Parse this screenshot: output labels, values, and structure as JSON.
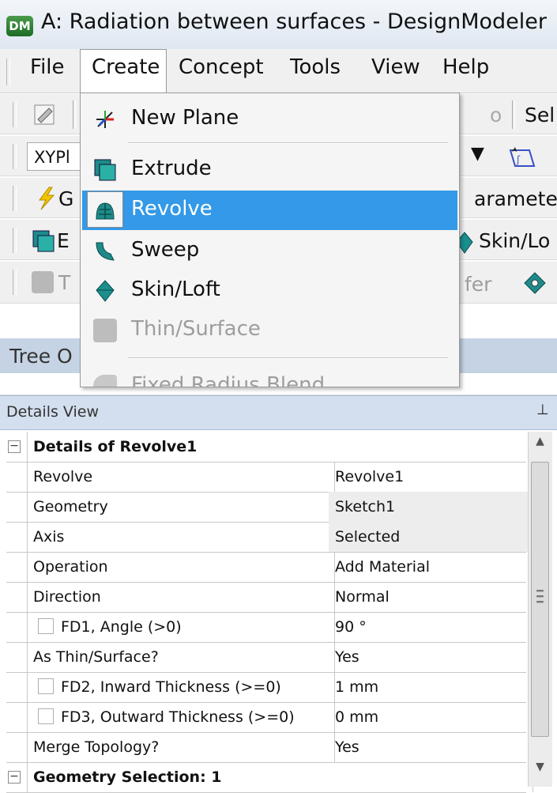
{
  "window": {
    "app_badge": "DM",
    "title": "A: Radiation between surfaces - DesignModeler"
  },
  "menubar": {
    "items": [
      "File",
      "Create",
      "Concept",
      "Tools",
      "View",
      "Help"
    ]
  },
  "toolbars": {
    "row1_partial_right_1": "o",
    "row1_partial_right_2": "Sel",
    "row2_plane_value": "XYPl",
    "row3_left_partial": "G",
    "row3_right_partial": "aramete",
    "row4_left_partial": "E",
    "row4_right_partial": "Skin/Lo",
    "row5_left_partial": "T",
    "row5_right_partial": "fer"
  },
  "tree_outline": {
    "title_partial": "Tree O"
  },
  "create_menu": {
    "items": [
      {
        "label": "New Plane",
        "icon": "new-plane-icon",
        "state": "normal"
      },
      {
        "label": "Extrude",
        "icon": "extrude-icon",
        "state": "normal"
      },
      {
        "label": "Revolve",
        "icon": "revolve-icon",
        "state": "selected"
      },
      {
        "label": "Sweep",
        "icon": "sweep-icon",
        "state": "normal"
      },
      {
        "label": "Skin/Loft",
        "icon": "skin-loft-icon",
        "state": "normal"
      },
      {
        "label": "Thin/Surface",
        "icon": "thin-surface-icon",
        "state": "disabled"
      },
      {
        "label": "Fixed Radius Blend",
        "icon": "blend-icon",
        "state": "disabled"
      }
    ]
  },
  "details_view": {
    "title": "Details View",
    "groups": [
      {
        "label": "Details of Revolve1"
      },
      {
        "label": "Geometry Selection: 1"
      }
    ],
    "rows": [
      {
        "label": "Revolve",
        "value": "Revolve1",
        "checkbox": false,
        "shaded": false
      },
      {
        "label": "Geometry",
        "value": "Sketch1",
        "checkbox": false,
        "shaded": true
      },
      {
        "label": "Axis",
        "value": "Selected",
        "checkbox": false,
        "shaded": true
      },
      {
        "label": "Operation",
        "value": "Add Material",
        "checkbox": false,
        "shaded": false
      },
      {
        "label": "Direction",
        "value": "Normal",
        "checkbox": false,
        "shaded": false
      },
      {
        "label": "FD1,  Angle (>0)",
        "value": "90 °",
        "checkbox": true,
        "shaded": false
      },
      {
        "label": "As Thin/Surface?",
        "value": "Yes",
        "checkbox": false,
        "shaded": false
      },
      {
        "label": "FD2,  Inward Thickness (>=0)",
        "value": "1 mm",
        "checkbox": true,
        "shaded": false
      },
      {
        "label": "FD3,  Outward Thickness (>=0)",
        "value": "0 mm",
        "checkbox": true,
        "shaded": false
      },
      {
        "label": "Merge Topology?",
        "value": "Yes",
        "checkbox": false,
        "shaded": false
      }
    ]
  },
  "colors": {
    "selection": "#3399e8",
    "title_bar": "#dfe7f1",
    "panel_header": "#c5d3e4"
  }
}
